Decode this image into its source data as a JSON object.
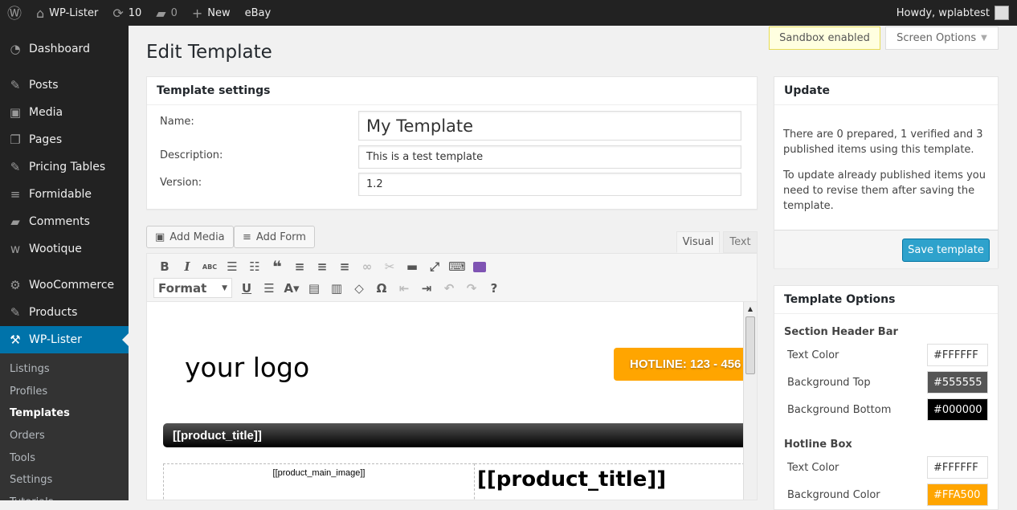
{
  "adminbar": {
    "site": "WP-Lister",
    "updates": "10",
    "comments": "0",
    "new": "New",
    "ebay": "eBay",
    "howdy": "Howdy, wplabtest"
  },
  "sidebar": {
    "items": [
      {
        "label": "Dashboard",
        "icon": "dashboard-icon",
        "glyph": "◔"
      },
      {
        "label": "Posts",
        "icon": "pin-icon",
        "glyph": "✎"
      },
      {
        "label": "Media",
        "icon": "media-icon",
        "glyph": "▣"
      },
      {
        "label": "Pages",
        "icon": "pages-icon",
        "glyph": "❐"
      },
      {
        "label": "Pricing Tables",
        "icon": "pin-icon",
        "glyph": "✎"
      },
      {
        "label": "Formidable",
        "icon": "form-icon",
        "glyph": "≡"
      },
      {
        "label": "Comments",
        "icon": "comment-icon",
        "glyph": "▰"
      },
      {
        "label": "Wootique",
        "icon": "woo-icon",
        "glyph": "w"
      },
      {
        "label": "WooCommerce",
        "icon": "woocommerce-icon",
        "glyph": "⚙"
      },
      {
        "label": "Products",
        "icon": "pin-icon",
        "glyph": "✎"
      },
      {
        "label": "WP-Lister",
        "icon": "hammer-icon",
        "glyph": "⚒"
      }
    ],
    "submenu": [
      "Listings",
      "Profiles",
      "Templates",
      "Orders",
      "Tools",
      "Settings",
      "Tutorials"
    ]
  },
  "page_title": "Edit Template",
  "sandbox": "Sandbox enabled",
  "screen_options": "Screen Options",
  "settings": {
    "title": "Template settings",
    "name_label": "Name:",
    "name_value": "My Template",
    "desc_label": "Description:",
    "desc_value": "This is a test template",
    "version_label": "Version:",
    "version_value": "1.2"
  },
  "editor": {
    "add_media": "Add Media",
    "add_form": "Add Form",
    "tab_visual": "Visual",
    "tab_text": "Text",
    "format": "Format",
    "preview": {
      "logo": "your logo",
      "hotline": "HOTLINE: 123 - 456",
      "header_title": "[[product_title]]",
      "main_image": "[[product_main_image]]",
      "title": "[[product_title]]"
    }
  },
  "update": {
    "title": "Update",
    "text1": "There are 0 prepared, 1 verified and 3 published items using this template.",
    "text2": "To update already published items you need to revise them after saving the template.",
    "save": "Save template"
  },
  "options": {
    "title": "Template Options",
    "section1": "Section Header Bar",
    "s1": [
      {
        "label": "Text Color",
        "value": "#FFFFFF"
      },
      {
        "label": "Background Top",
        "value": "#555555"
      },
      {
        "label": "Background Bottom",
        "value": "#000000"
      }
    ],
    "section2": "Hotline Box",
    "s2": [
      {
        "label": "Text Color",
        "value": "#FFFFFF"
      },
      {
        "label": "Background Color",
        "value": "#FFA500"
      }
    ]
  },
  "colors": {
    "accent": "#0073aa",
    "button": "#2ea2cc",
    "hotline": "#FFA500"
  }
}
